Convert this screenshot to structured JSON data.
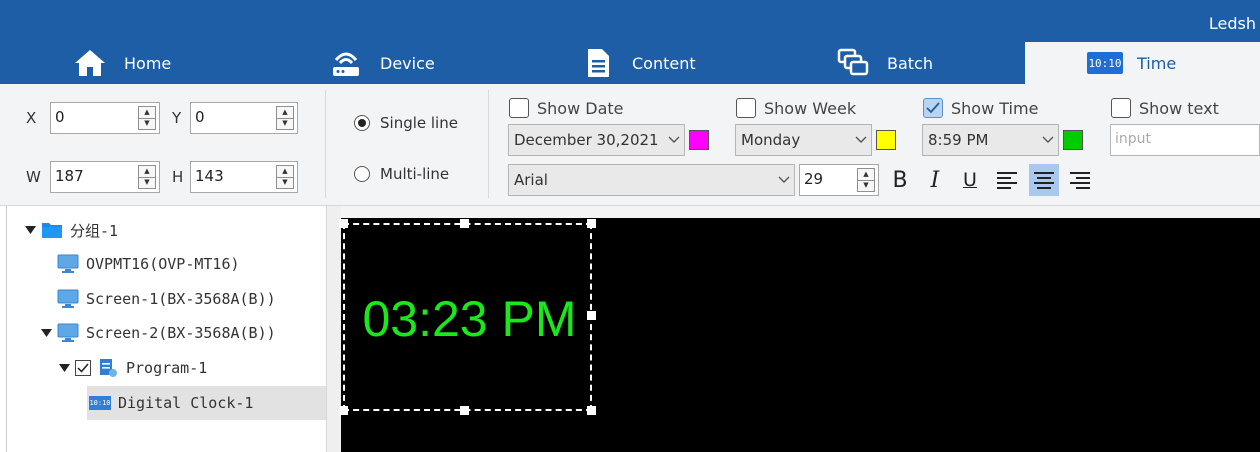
{
  "app": {
    "title": "Ledsh"
  },
  "tabs": [
    {
      "label": "Home",
      "icon": "home-icon"
    },
    {
      "label": "Device",
      "icon": "device-icon"
    },
    {
      "label": "Content",
      "icon": "document-icon"
    },
    {
      "label": "Batch",
      "icon": "batch-icon"
    },
    {
      "label": "Time",
      "icon": "digital-clock-icon",
      "active": true
    }
  ],
  "position": {
    "x_label": "X",
    "x_value": "0",
    "y_label": "Y",
    "y_value": "0",
    "w_label": "W",
    "w_value": "187",
    "h_label": "H",
    "h_value": "143"
  },
  "line_mode": {
    "single_label": "Single line",
    "single_selected": true,
    "multi_label": "Multi-line",
    "multi_selected": false
  },
  "date": {
    "show_label": "Show Date",
    "checked": false,
    "value": "December 30,2021",
    "color": "#ff00ff"
  },
  "week": {
    "show_label": "Show Week",
    "checked": false,
    "value": "Monday",
    "color": "#ffff00"
  },
  "time": {
    "show_label": "Show Time",
    "checked": true,
    "value": "8:59 PM",
    "color": "#00cc00"
  },
  "text": {
    "show_label": "Show text",
    "checked": false,
    "placeholder": "input"
  },
  "font": {
    "family": "Arial",
    "size": "29",
    "bold_label": "B",
    "italic_label": "I",
    "underline_label": "U",
    "align_selected": "center"
  },
  "tree": {
    "group": "分组-1",
    "devices": [
      "OVPMT16(OVP-MT16)",
      "Screen-1(BX-3568A(B))",
      "Screen-2(BX-3568A(B))"
    ],
    "program": "Program-1",
    "program_checked": true,
    "item": "Digital Clock-1"
  },
  "canvas": {
    "clock_text": "03:23 PM",
    "clock_color": "#1be81b",
    "background": "#000000"
  },
  "colors": {
    "accent": "#1d5ea6",
    "ribbon": "#f3f4f6"
  }
}
